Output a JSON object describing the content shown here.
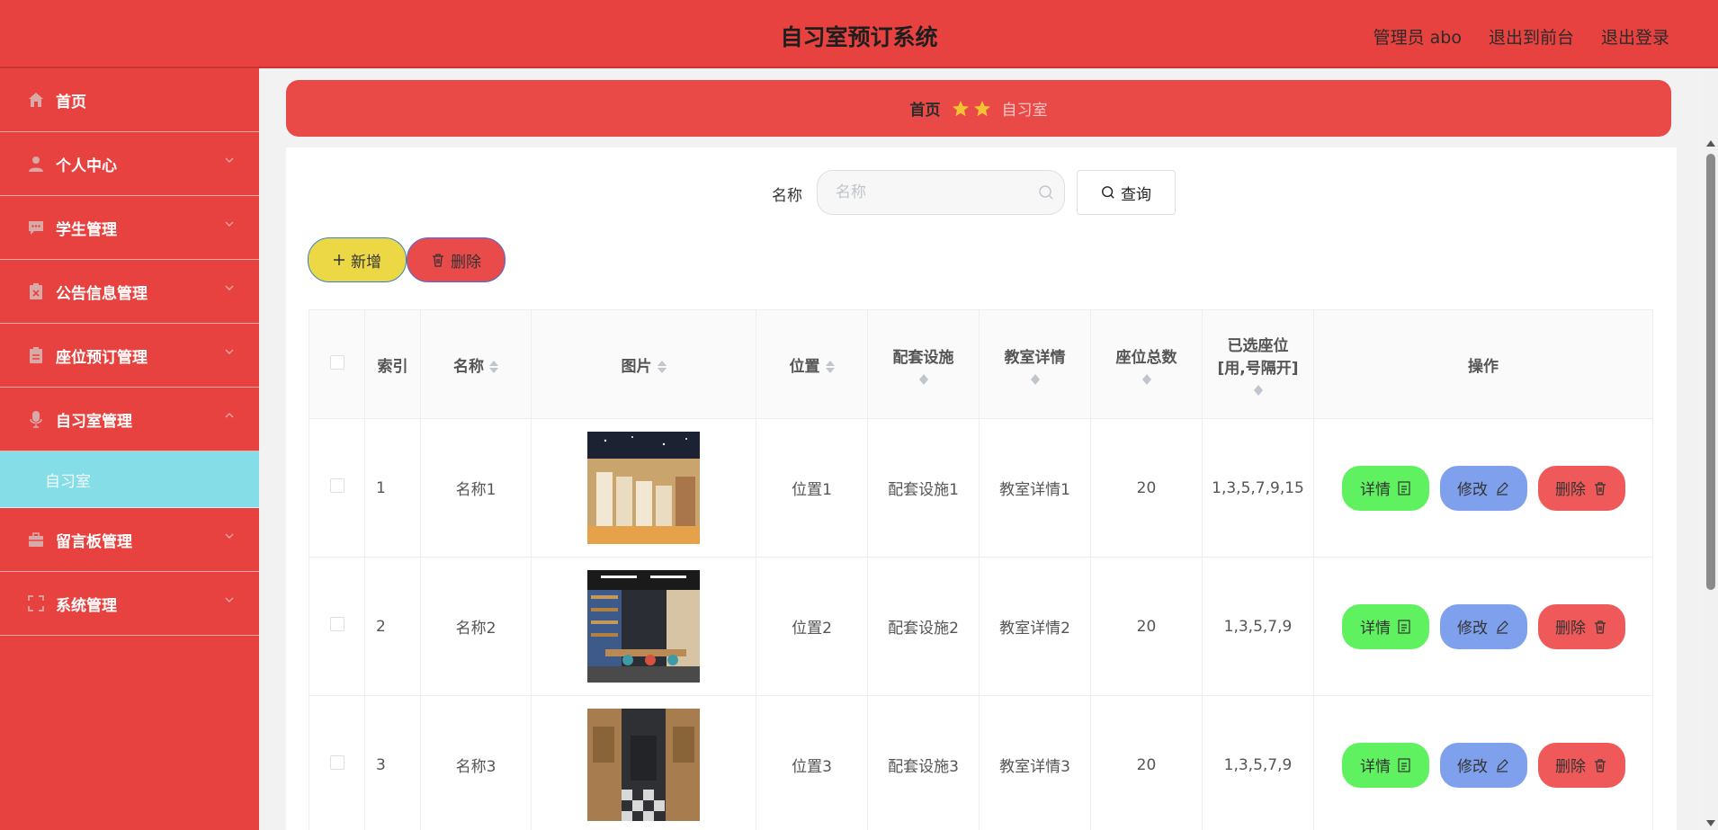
{
  "header": {
    "title": "自习室预订系统",
    "user": "管理员 abo",
    "exit_front": "退出到前台",
    "logout": "退出登录"
  },
  "sidebar": {
    "items": [
      {
        "label": "首页",
        "icon": "home-icon"
      },
      {
        "label": "个人中心",
        "icon": "user-icon"
      },
      {
        "label": "学生管理",
        "icon": "chat-icon"
      },
      {
        "label": "公告信息管理",
        "icon": "notice-icon"
      },
      {
        "label": "座位预订管理",
        "icon": "clipboard-icon"
      },
      {
        "label": "自习室管理",
        "icon": "microphone-icon"
      },
      {
        "label": "留言板管理",
        "icon": "briefcase-icon"
      },
      {
        "label": "系统管理",
        "icon": "frame-icon"
      }
    ],
    "active_sub": "自习室"
  },
  "breadcrumb": {
    "home": "首页",
    "current": "自习室"
  },
  "search": {
    "label": "名称",
    "placeholder": "名称",
    "button": "查询"
  },
  "actions": {
    "add": "新增",
    "delete": "删除"
  },
  "table": {
    "headers": {
      "index": "索引",
      "name": "名称",
      "image": "图片",
      "location": "位置",
      "facilities": "配套设施",
      "detail": "教室详情",
      "seats": "座位总数",
      "selected_line1": "已选座位",
      "selected_line2": "[用,号隔开]",
      "ops": "操作"
    },
    "rows": [
      {
        "index": "1",
        "name": "名称1",
        "location": "位置1",
        "facilities": "配套设施1",
        "detail": "教室详情1",
        "seats": "20",
        "selected": "1,3,5,7,9,15"
      },
      {
        "index": "2",
        "name": "名称2",
        "location": "位置2",
        "facilities": "配套设施2",
        "detail": "教室详情2",
        "seats": "20",
        "selected": "1,3,5,7,9"
      },
      {
        "index": "3",
        "name": "名称3",
        "location": "位置3",
        "facilities": "配套设施3",
        "detail": "教室详情3",
        "seats": "20",
        "selected": "1,3,5,7,9"
      }
    ],
    "op_labels": {
      "detail": "详情",
      "edit": "修改",
      "remove": "删除"
    }
  },
  "colors": {
    "primary": "#e7423f",
    "submenu_active": "#84dde7",
    "add_button": "#ecd845",
    "detail_button": "#5ff15f",
    "edit_button": "#7fa0ec",
    "remove_button": "#ef5959"
  }
}
